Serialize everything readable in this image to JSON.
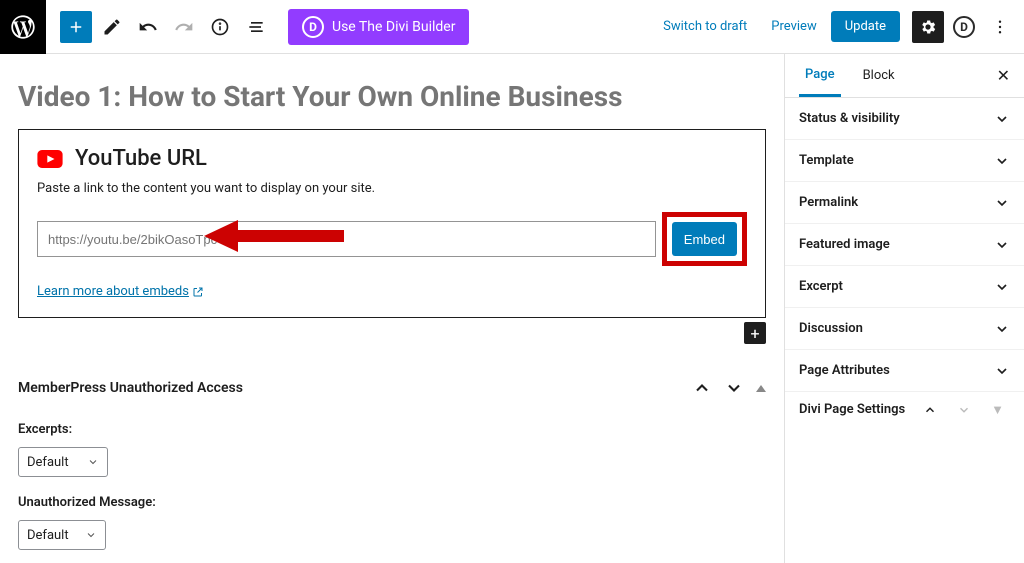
{
  "topbar": {
    "divi_button": "Use The Divi Builder",
    "switch_draft": "Switch to draft",
    "preview": "Preview",
    "update": "Update"
  },
  "editor": {
    "title": "Video 1: How to Start Your Own Online Business",
    "block": {
      "heading": "YouTube URL",
      "description": "Paste a link to the content you want to display on your site.",
      "placeholder": "https://youtu.be/2bikOasoTpc",
      "embed_label": "Embed",
      "learn_link": "Learn more about embeds"
    },
    "meta": {
      "panel_title": "MemberPress Unauthorized Access",
      "excerpts_label": "Excerpts:",
      "excerpts_value": "Default",
      "unauthorized_label": "Unauthorized Message:",
      "unauthorized_value": "Default"
    }
  },
  "sidebar": {
    "tabs": {
      "page": "Page",
      "block": "Block"
    },
    "panels": [
      "Status & visibility",
      "Template",
      "Permalink",
      "Featured image",
      "Excerpt",
      "Discussion",
      "Page Attributes"
    ],
    "divi_settings": "Divi Page Settings"
  }
}
